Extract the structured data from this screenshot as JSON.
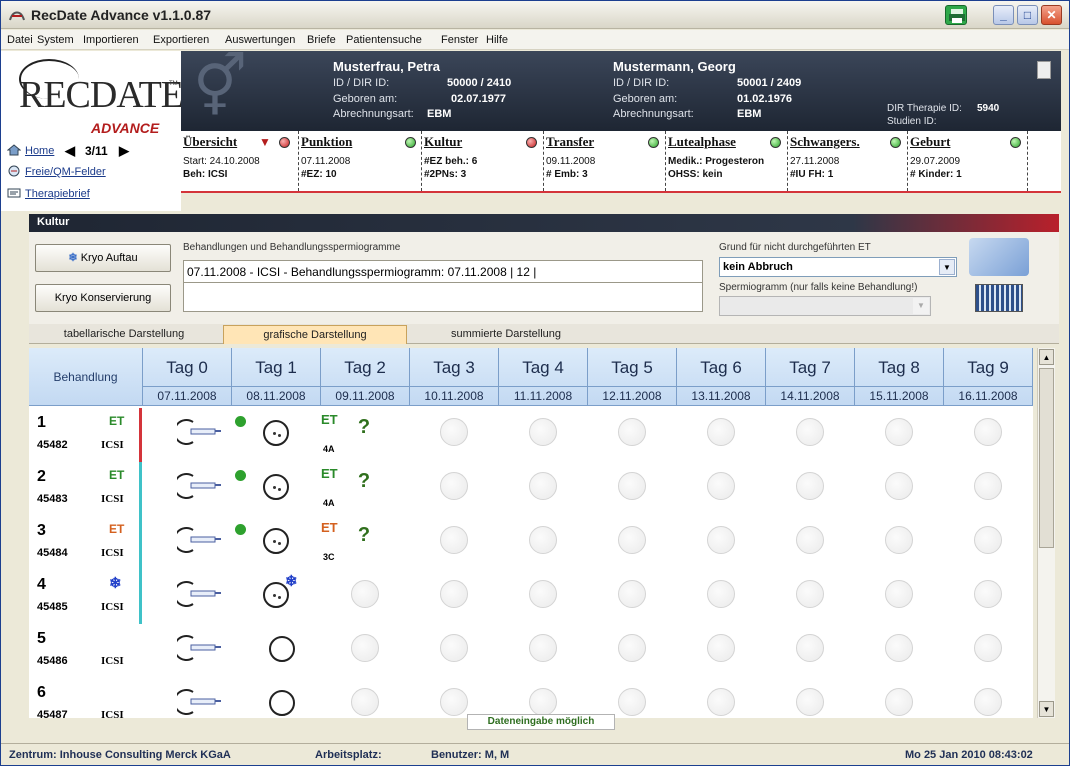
{
  "window": {
    "title": "RecDate Advance v1.1.0.87"
  },
  "menu": [
    "Datei",
    "System",
    "Importieren",
    "Exportieren",
    "Auswertungen",
    "Briefe",
    "Patientensuche",
    "Fenster",
    "Hilfe"
  ],
  "logo": {
    "brand": "RECDATE",
    "sub": "ADVANCE",
    "tm": "TM"
  },
  "nav": {
    "home": "Home",
    "counter": "3/11",
    "freie": "Freie/QM-Felder",
    "therapie": "Therapiebrief"
  },
  "patient_female": {
    "name": "Musterfrau, Petra",
    "id_label": "ID / DIR ID:",
    "id_value": "50000 / 2410",
    "born_label": "Geboren am:",
    "born_value": "02.07.1977",
    "billing_label": "Abrechnungsart:",
    "billing_value": "EBM"
  },
  "patient_male": {
    "name": "Mustermann, Georg",
    "id_label": "ID / DIR ID:",
    "id_value": "50001 / 2409",
    "born_label": "Geboren am:",
    "born_value": "01.02.1976",
    "billing_label": "Abrechnungsart:",
    "billing_value": "EBM"
  },
  "dir": {
    "therapie_label": "DIR Therapie ID:",
    "therapie_value": "5940",
    "studien_label": "Studien ID:"
  },
  "phases": [
    {
      "name": "Übersicht",
      "l1": "Start: 24.10.2008",
      "l2": "Beh: ICSI"
    },
    {
      "name": "Punktion",
      "l1": "07.11.2008",
      "l2": "#EZ: 10"
    },
    {
      "name": "Kultur",
      "l1": "#EZ beh.: 6",
      "l2": "#2PNs: 3"
    },
    {
      "name": "Transfer",
      "l1": "09.11.2008",
      "l2": "# Emb: 3"
    },
    {
      "name": "Lutealphase",
      "l1": "Medik.: Progesteron",
      "l2": "OHSS: kein"
    },
    {
      "name": "Schwangers.",
      "l1": "27.11.2008",
      "l2": "#IU FH: 1"
    },
    {
      "name": "Geburt",
      "l1": "29.07.2009",
      "l2": "# Kinder: 1"
    }
  ],
  "section": {
    "title": "Kultur"
  },
  "controls": {
    "kryo_auftau": "Kryo Auftau",
    "kryo_konservierung": "Kryo Konservierung",
    "treat_legend": "Behandlungen und Behandlungsspermiogramme",
    "treat_line": "07.11.2008 - ICSI - Behandlungsspermiogramm: 07.11.2008 | 12 |",
    "grund_label": "Grund für nicht durchgeführten ET",
    "grund_value": "kein Abbruch",
    "sperm_label": "Spermiogramm (nur falls keine Behandlung!)"
  },
  "tabs": [
    "tabellarische Darstellung",
    "grafische Darstellung",
    "summierte Darstellung"
  ],
  "grid": {
    "behandlung": "Behandlung",
    "days": [
      {
        "label": "Tag 0",
        "date": "07.11.2008"
      },
      {
        "label": "Tag 1",
        "date": "08.11.2008"
      },
      {
        "label": "Tag 2",
        "date": "09.11.2008"
      },
      {
        "label": "Tag 3",
        "date": "10.11.2008"
      },
      {
        "label": "Tag 4",
        "date": "11.11.2008"
      },
      {
        "label": "Tag 5",
        "date": "12.11.2008"
      },
      {
        "label": "Tag 6",
        "date": "13.11.2008"
      },
      {
        "label": "Tag 7",
        "date": "14.11.2008"
      },
      {
        "label": "Tag 8",
        "date": "15.11.2008"
      },
      {
        "label": "Tag 9",
        "date": "16.11.2008"
      }
    ],
    "rows": [
      {
        "num": "1",
        "id": "45482",
        "type": "ICSI",
        "badge": "ET",
        "grade": "4A"
      },
      {
        "num": "2",
        "id": "45483",
        "type": "ICSI",
        "badge": "ET",
        "grade": "4A"
      },
      {
        "num": "3",
        "id": "45484",
        "type": "ICSI",
        "badge": "ET",
        "grade": "3C"
      },
      {
        "num": "4",
        "id": "45485",
        "type": "ICSI",
        "badge": "",
        "grade": ""
      },
      {
        "num": "5",
        "id": "45486",
        "type": "ICSI",
        "badge": "",
        "grade": ""
      },
      {
        "num": "6",
        "id": "45487",
        "type": "ICSI",
        "badge": "",
        "grade": ""
      }
    ],
    "data_status": "Dateneingabe möglich"
  },
  "status": {
    "zentrum": "Zentrum: Inhouse Consulting Merck KGaA",
    "arbeitsplatz": "Arbeitsplatz:",
    "benutzer": "Benutzer: M, M",
    "datetime": "Mo 25 Jan 2010 08:43:02"
  },
  "colors": {
    "accent_red": "#b31d1d",
    "status_green": "#2ea12e",
    "header_dark": "#1e2633",
    "et_green": "#2a8a2a",
    "et_orange": "#d4611f",
    "freeze_blue": "#2240c9"
  }
}
